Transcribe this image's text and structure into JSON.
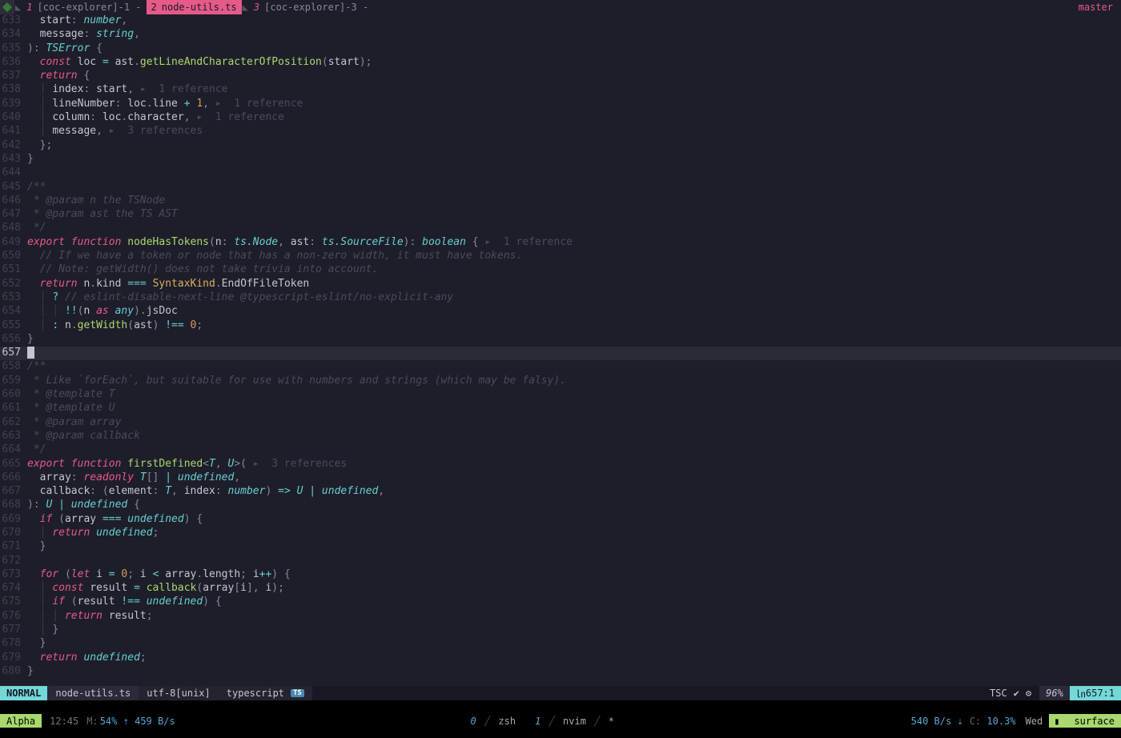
{
  "tabs": [
    {
      "num": "1",
      "label": "[coc-explorer]-1 -"
    },
    {
      "num": "2",
      "label": "node-utils.ts"
    },
    {
      "num": "3",
      "label": "[coc-explorer]-3 -"
    }
  ],
  "branch": "master ",
  "gutter_start": 633,
  "current_line": 657,
  "hints": {
    "ref1a": " ▸  1 reference",
    "ref1b": " ▸  1 reference",
    "ref1c": " ▸  1 reference",
    "ref3": " ▸  3 references",
    "ref1d": " ▸  1 reference",
    "ref3b": " ▸  3 references"
  },
  "code": {
    "l633_id1": "start",
    "l633_ty": "number",
    "l634_id1": "message",
    "l634_ty": "string",
    "l635_ty": "TSError",
    "l636_kw1": "const",
    "l636_id1": "loc",
    "l636_id2": "ast",
    "l636_fn": "getLineAndCharacterOfPosition",
    "l636_id3": "start",
    "l637_kw": "return",
    "l638_id1": "index",
    "l638_id2": "start",
    "l639_id1": "lineNumber",
    "l639_id2": "loc",
    "l639_id3": "line",
    "l639_num": "1",
    "l640_id1": "column",
    "l640_id2": "loc",
    "l640_id3": "character",
    "l641_id1": "message",
    "l645_cm": "/**",
    "l646_cm": " * @param n the TSNode",
    "l647_cm": " * @param ast the TS AST",
    "l648_cm": " */",
    "l649_kw1": "export",
    "l649_kw2": "function",
    "l649_fn": "nodeHasTokens",
    "l649_id1": "n",
    "l649_ty1": "ts.Node",
    "l649_id2": "ast",
    "l649_ty2": "ts.SourceFile",
    "l649_ty3": "boolean",
    "l650_cm": "// If we have a token or node that has a non-zero width, it must have tokens.",
    "l651_cm": "// Note: getWidth() does not take trivia into account.",
    "l652_kw": "return",
    "l652_id1": "n",
    "l652_id2": "kind",
    "l652_cl": "SyntaxKind",
    "l652_id3": "EndOfFileToken",
    "l653_cm": "// eslint-disable-next-line @typescript-eslint/no-explicit-any",
    "l654_id1": "n",
    "l654_kw": "as",
    "l654_ty": "any",
    "l654_id2": "jsDoc",
    "l655_id1": "n",
    "l655_fn": "getWidth",
    "l655_id2": "ast",
    "l655_num": "0",
    "l658_cm": "/**",
    "l659_cm": " * Like `forEach`, but suitable for use with numbers and strings (which may be falsy).",
    "l660_cm": " * @template T",
    "l661_cm": " * @template U",
    "l662_cm": " * @param array",
    "l663_cm": " * @param callback",
    "l664_cm": " */",
    "l665_kw1": "export",
    "l665_kw2": "function",
    "l665_fn": "firstDefined",
    "l665_ty1": "T",
    "l665_ty2": "U",
    "l666_id1": "array",
    "l666_kw": "readonly",
    "l666_ty1": "T",
    "l666_ty2": "undefined",
    "l667_id1": "callback",
    "l667_id2": "element",
    "l667_ty1": "T",
    "l667_id3": "index",
    "l667_ty2": "number",
    "l667_ty3": "U",
    "l667_ty4": "undefined",
    "l668_ty1": "U",
    "l668_ty2": "undefined",
    "l669_kw": "if",
    "l669_id1": "array",
    "l669_ty": "undefined",
    "l670_kw": "return",
    "l670_ty": "undefined",
    "l673_kw1": "for",
    "l673_kw2": "let",
    "l673_id1": "i",
    "l673_num1": "0",
    "l673_id2": "i",
    "l673_id3": "array",
    "l673_id4": "length",
    "l673_id5": "i",
    "l674_kw": "const",
    "l674_id1": "result",
    "l674_fn": "callback",
    "l674_id2": "array",
    "l674_id3": "i",
    "l674_id4": "i",
    "l675_kw": "if",
    "l675_id1": "result",
    "l675_ty": "undefined",
    "l676_kw": "return",
    "l676_id1": "result",
    "l679_kw": "return",
    "l679_ty": "undefined"
  },
  "statusline": {
    "mode": "NORMAL",
    "file": "node-utils.ts",
    "enc": "utf-8[unix]",
    "ft": "typescript",
    "ft_badge": "TS",
    "tsc": "TSC",
    "check": "✔",
    "gear": "⚙",
    "pct": "96%",
    "pos": "657:1",
    "pos_icon": "㏑"
  },
  "tmux": {
    "session": "Alpha",
    "time": "12:45",
    "mem_label": "M:",
    "mem_pct": "54%",
    "mem_up": "⇡",
    "mem_rate": "459 B/s",
    "win0_num": "0",
    "win0_name": "zsh",
    "win1_num": "1",
    "win1_name": "nvim",
    "win1_flag": "*",
    "net_dn": "540 B/s",
    "net_dn_icon": "⇣",
    "cpu_label": "C:",
    "cpu_pct": "10.3%",
    "day": "Wed",
    "bat_icon": "▮",
    "bat": "",
    "host": "surface"
  }
}
